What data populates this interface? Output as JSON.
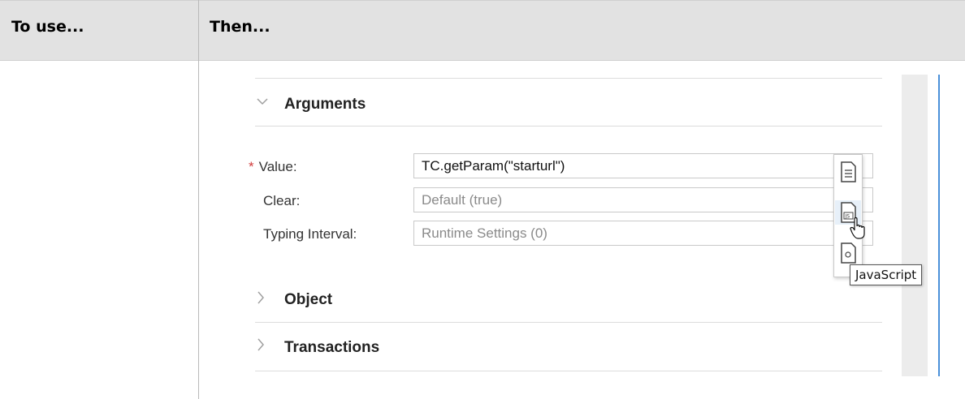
{
  "table": {
    "col1_header": "To use...",
    "col2_header": "Then..."
  },
  "panel": {
    "arguments_title": "Arguments",
    "object_title": "Object",
    "transactions_title": "Transactions",
    "required_mark": "*",
    "fields": {
      "value_label": "Value:",
      "value_text": "TC.getParam(\"starturl\")",
      "clear_label": "Clear:",
      "clear_text": "Default (true)",
      "typing_label": "Typing Interval:",
      "typing_text": "Runtime Settings (0)"
    },
    "tooltip": "JavaScript",
    "popup_items": [
      "text-value-icon",
      "javascript-icon",
      "parameter-icon"
    ],
    "colors": {
      "accent": "#4a90d9",
      "required": "#d13c3c",
      "header_bg": "#e2e2e2"
    }
  }
}
